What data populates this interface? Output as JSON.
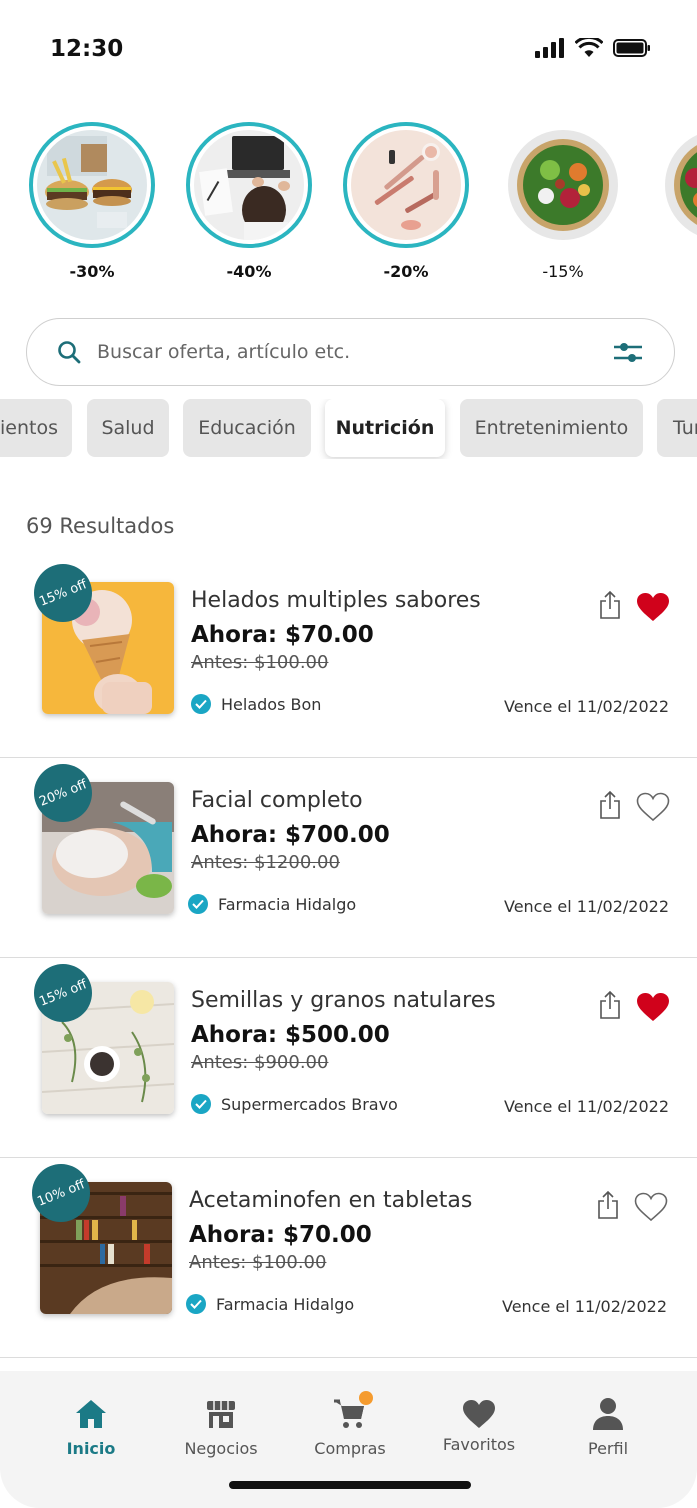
{
  "status_bar": {
    "time": "12:30"
  },
  "stories": [
    {
      "discount": "-30%",
      "image": "burgers"
    },
    {
      "discount": "-40%",
      "image": "laptop"
    },
    {
      "discount": "-20%",
      "image": "cosmetics"
    },
    {
      "discount": "-15%",
      "image": "salad-bowl"
    },
    {
      "discount": "",
      "image": "salad-bowl"
    }
  ],
  "search": {
    "placeholder": "Buscar oferta, artículo etc."
  },
  "categories": [
    {
      "label": "ientos",
      "active": false
    },
    {
      "label": "Salud",
      "active": false
    },
    {
      "label": "Educación",
      "active": false
    },
    {
      "label": "Nutrición",
      "active": true
    },
    {
      "label": "Entretenimiento",
      "active": false
    },
    {
      "label": "Tur",
      "active": false
    }
  ],
  "results_label": "69 Resultados",
  "offers": [
    {
      "badge": "15% off",
      "title": "Helados multiples sabores",
      "now": "Ahora: $70.00",
      "before": "Antes: $100.00",
      "merchant": "Helados Bon",
      "expiry": "Vence el 11/02/2022",
      "favorited": true,
      "image": "ice-cream"
    },
    {
      "badge": "20% off",
      "title": "Facial completo",
      "now": "Ahora: $700.00",
      "before": "Antes: $1200.00",
      "merchant": "Farmacia Hidalgo",
      "expiry": "Vence el 11/02/2022",
      "favorited": false,
      "image": "facial"
    },
    {
      "badge": "15% off",
      "title": "Semillas y granos natulares",
      "now": "Ahora: $500.00",
      "before": "Antes: $900.00",
      "merchant": "Supermercados Bravo",
      "expiry": "Vence el 11/02/2022",
      "favorited": true,
      "image": "seeds"
    },
    {
      "badge": "10% off",
      "title": "Acetaminofen en tabletas",
      "now": "Ahora: $70.00",
      "before": "Antes: $100.00",
      "merchant": "Farmacia Hidalgo",
      "expiry": "Vence el 11/02/2022",
      "favorited": false,
      "image": "bookshelf"
    }
  ],
  "tabs": [
    {
      "label": "Inicio",
      "icon": "home-icon",
      "active": true
    },
    {
      "label": "Negocios",
      "icon": "store-icon",
      "active": false
    },
    {
      "label": "Compras",
      "icon": "cart-icon",
      "active": false,
      "has_notification_dot": true
    },
    {
      "label": "Favoritos",
      "icon": "heart-icon",
      "active": false
    },
    {
      "label": "Perfil",
      "icon": "person-icon",
      "active": false
    }
  ],
  "colors": {
    "accent": "#2bb5c0",
    "badge": "#1d6e78",
    "heart_active": "#d0021b",
    "tab_active": "#1b7a86",
    "verified": "#1aa6c4"
  }
}
